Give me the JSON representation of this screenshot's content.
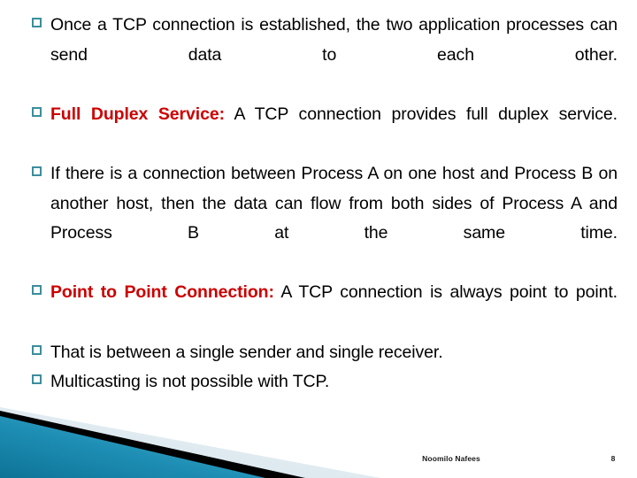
{
  "slide": {
    "background_color": "#ffffff",
    "bullet_marker_color": "#3c8e9b",
    "highlight_color": "#cc0000",
    "body_text_color": "#000000"
  },
  "body": {
    "bullets": [
      {
        "id": "bullet-1",
        "highlight": "",
        "text": "Once a TCP connection is established, the two application processes can send data to each other."
      },
      {
        "id": "bullet-2",
        "highlight": "Full Duplex Service:",
        "text": " A TCP connection provides full duplex service."
      },
      {
        "id": "bullet-3",
        "highlight": "",
        "text": "If there is a connection between Process A on one host and Process B on another host, then the data can flow from both sides of Process A and Process B at the same time."
      },
      {
        "id": "bullet-4",
        "highlight": "Point to Point Connection:",
        "text": " A TCP connection is always point to point."
      },
      {
        "id": "bullet-5",
        "highlight": "",
        "text": "That is between a single sender and single receiver."
      },
      {
        "id": "bullet-6",
        "highlight": "",
        "text": "Multicasting is not possible with TCP."
      }
    ]
  },
  "decoration": {
    "teal_light": "#4fb3d0",
    "teal_mid": "#1f8fb5",
    "teal_dark": "#0d7396",
    "stripe_color": "#000000",
    "pale_wedge_color": "#dfe9ef"
  },
  "footer": {
    "author": "Noomilo Nafees",
    "page_number": "8"
  }
}
